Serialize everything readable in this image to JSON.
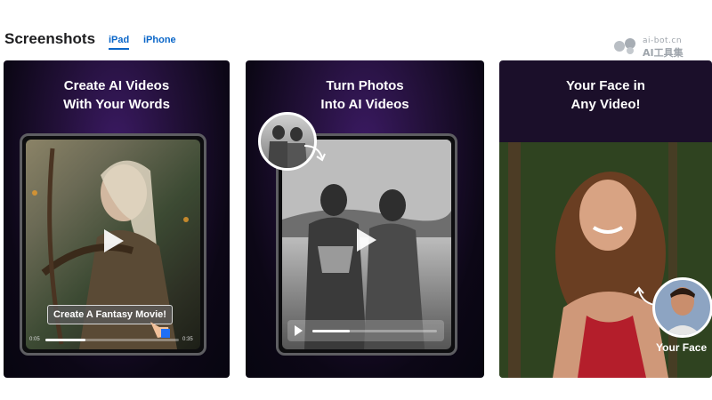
{
  "section": {
    "title": "Screenshots",
    "tabs": [
      {
        "label": "iPad",
        "active": true
      },
      {
        "label": "iPhone",
        "active": false
      }
    ]
  },
  "watermark": {
    "line1": "ai-bot.cn",
    "line2": "AI工具集"
  },
  "cards": [
    {
      "title": "Create AI Videos\nWith Your Words",
      "prompt": "Create A Fantasy Movie!",
      "time_start": "0:05",
      "time_end": "0:35"
    },
    {
      "title": "Turn Photos\nInto AI Videos"
    },
    {
      "title": "Your Face in\nAny Video!",
      "face_label": "Your Face"
    }
  ],
  "colors": {
    "accent": "#0a66c8",
    "card_purple": "#3b1a63",
    "card_dark": "#0c0716"
  },
  "icons": [
    "play-icon",
    "curved-arrow-icon",
    "cursor-hand-icon"
  ]
}
